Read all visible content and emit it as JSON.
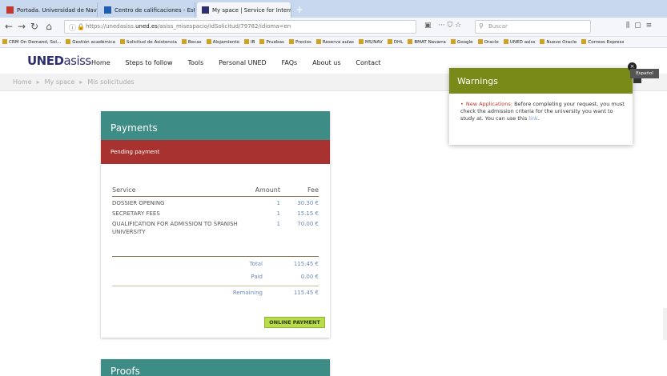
{
  "browser": {
    "tabs": [
      {
        "label": "Portada. Universidad de Nava",
        "favicon_color": "#c0392b"
      },
      {
        "label": "Centro de calificaciones - Estu",
        "favicon_color": "#1f5fb0"
      },
      {
        "label": "My space | Service for Internat",
        "favicon_color": "#2d2f6e"
      }
    ],
    "new_tab": "+",
    "url_prefix": "https://unedasiss.",
    "url_domain": "uned.es",
    "url_path": "/asiss_misespacio/idSolicitud/79782/idioma=en",
    "search_placeholder": "Buscar",
    "bookmarks": [
      "CRM On Demand, Sol...",
      "Gestión académica",
      "Solicitud de Asistencia",
      "Becas",
      "Alojamiento",
      "IB",
      "Pruebas",
      "Precios",
      "Reserva aulas",
      "MS/NAV",
      "DHL",
      "BMAT Navarra",
      "Google",
      "Oracle",
      "UNED asiss",
      "Nuevo Oracle",
      "Correos Express"
    ]
  },
  "site": {
    "logo_bold": "UNED",
    "logo_thin": "asiss",
    "nav": [
      "Home",
      "Steps to follow",
      "Tools",
      "Personal UNED",
      "FAQs",
      "About us",
      "Contact"
    ],
    "breadcrumb": [
      "Home",
      "My space",
      "Mis solicitudes"
    ]
  },
  "payments": {
    "title": "Payments",
    "alert": "Pending payment",
    "columns": {
      "service": "Service",
      "amount": "Amount",
      "fee": "Fee"
    },
    "items": [
      {
        "service": "DOSSIER OPENING",
        "amount": "1",
        "fee": "30.30 €"
      },
      {
        "service": "SECRETARY FEES",
        "amount": "1",
        "fee": "15.15 €"
      },
      {
        "service": "QUALIFICATION FOR ADMISSION TO SPANISH UNIVERSITY",
        "amount": "1",
        "fee": "70.00 €"
      }
    ],
    "total_label": "Total",
    "total_value": "115.45 €",
    "paid_label": "Paid",
    "paid_value": "0.00 €",
    "remaining_label": "Remaining",
    "remaining_value": "115.45 €",
    "button": "ONLINE PAYMENT"
  },
  "proofs": {
    "title": "Proofs"
  },
  "warnings": {
    "title": "Warnings",
    "highlight": "New Applications:",
    "text": "Before completing your request, you must check the admission criteria for the university you want to study at. You can use this",
    "link": "link",
    "close": "×",
    "language": "Español"
  },
  "colors": {
    "teal": "#3d8c85",
    "alert_red": "#a8322f",
    "warn_olive": "#7a8a18",
    "pay_green": "#b9dc4a"
  }
}
